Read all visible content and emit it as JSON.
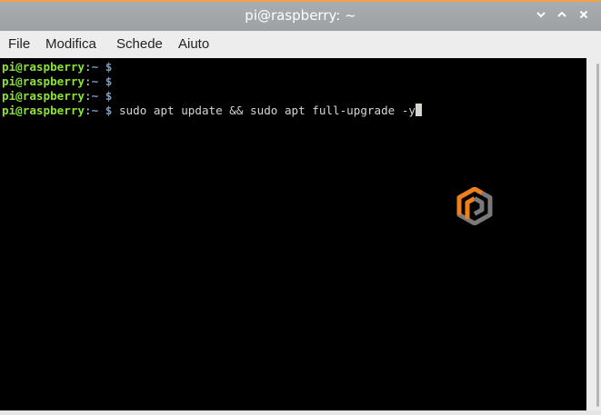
{
  "window": {
    "title": "pi@raspberry: ~",
    "controls": {
      "minimize_icon": "chevron-down-icon",
      "maximize_icon": "chevron-up-icon",
      "close_icon": "close-icon"
    },
    "accent_color": "#f0a24a"
  },
  "menu": {
    "items": [
      "File",
      "Modifica",
      "Schede",
      "Aiuto"
    ]
  },
  "terminal": {
    "background": "#000000",
    "prompt": {
      "user_host": "pi@raspberry",
      "colon": ":",
      "path": "~",
      "dollar": "$"
    },
    "lines": [
      {
        "command": ""
      },
      {
        "command": ""
      },
      {
        "command": ""
      },
      {
        "command": "sudo apt update && sudo apt full-upgrade -y"
      }
    ],
    "colors": {
      "user_host": "#8ae234",
      "path": "#729fcf",
      "text": "#d3d7cf"
    }
  },
  "watermark": {
    "icon": "hexagon-logo-icon",
    "colors": [
      "#f07f1a",
      "#7a7a7a"
    ]
  }
}
